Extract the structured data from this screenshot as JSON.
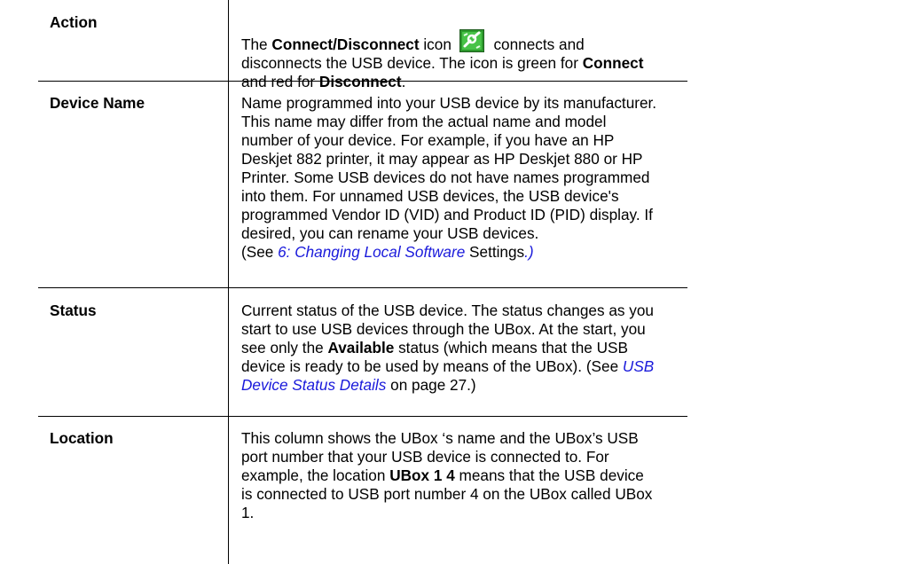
{
  "rows": [
    {
      "label": "Action",
      "desc": {
        "t1": "The ",
        "b1": "Connect/Disconnect",
        "t2": " icon ",
        "icon": "connect-disconnect-icon",
        "t3": " connects and disconnects the USB device. The icon is green for ",
        "b2": "Connect",
        "t4": " and red for ",
        "b3": "Disconnect",
        "t5": "."
      }
    },
    {
      "label": "Device Name",
      "desc": {
        "text": "Name programmed into your USB device by its manufacturer. This name may differ from the actual name and model number of your device. For example, if you have an HP Deskjet 882 printer, it may appear as HP Deskjet 880 or HP Printer. Some USB devices do not have names programmed into them. For unnamed USB devices, the USB device's programmed Vendor ID (VID) and Product ID (PID) display. If desired, you can rename your USB devices.",
        "see_pre": "(See ",
        "see_link": "6: Changing Local Software",
        "see_post": " Settings",
        "see_end": ".)"
      }
    },
    {
      "label": "Status",
      "desc": {
        "t1": "Current status of the USB device. The status changes as you start to use USB devices through the UBox. At the start, you see only the ",
        "b1": "Available",
        "t2": " status (which means that the USB device is ready to be used by means of the UBox). (See ",
        "link": "USB Device Status Details",
        "t3": "  on page 27.)"
      }
    },
    {
      "label": "Location",
      "desc": {
        "t1": "This column shows the UBox ‘s name and the UBox’s USB port number that your USB device is connected to. For example, the location ",
        "b1": "UBox 1  4",
        "t2": " means that the USB device is connected to USB port number 4 on the UBox called UBox 1."
      }
    }
  ]
}
